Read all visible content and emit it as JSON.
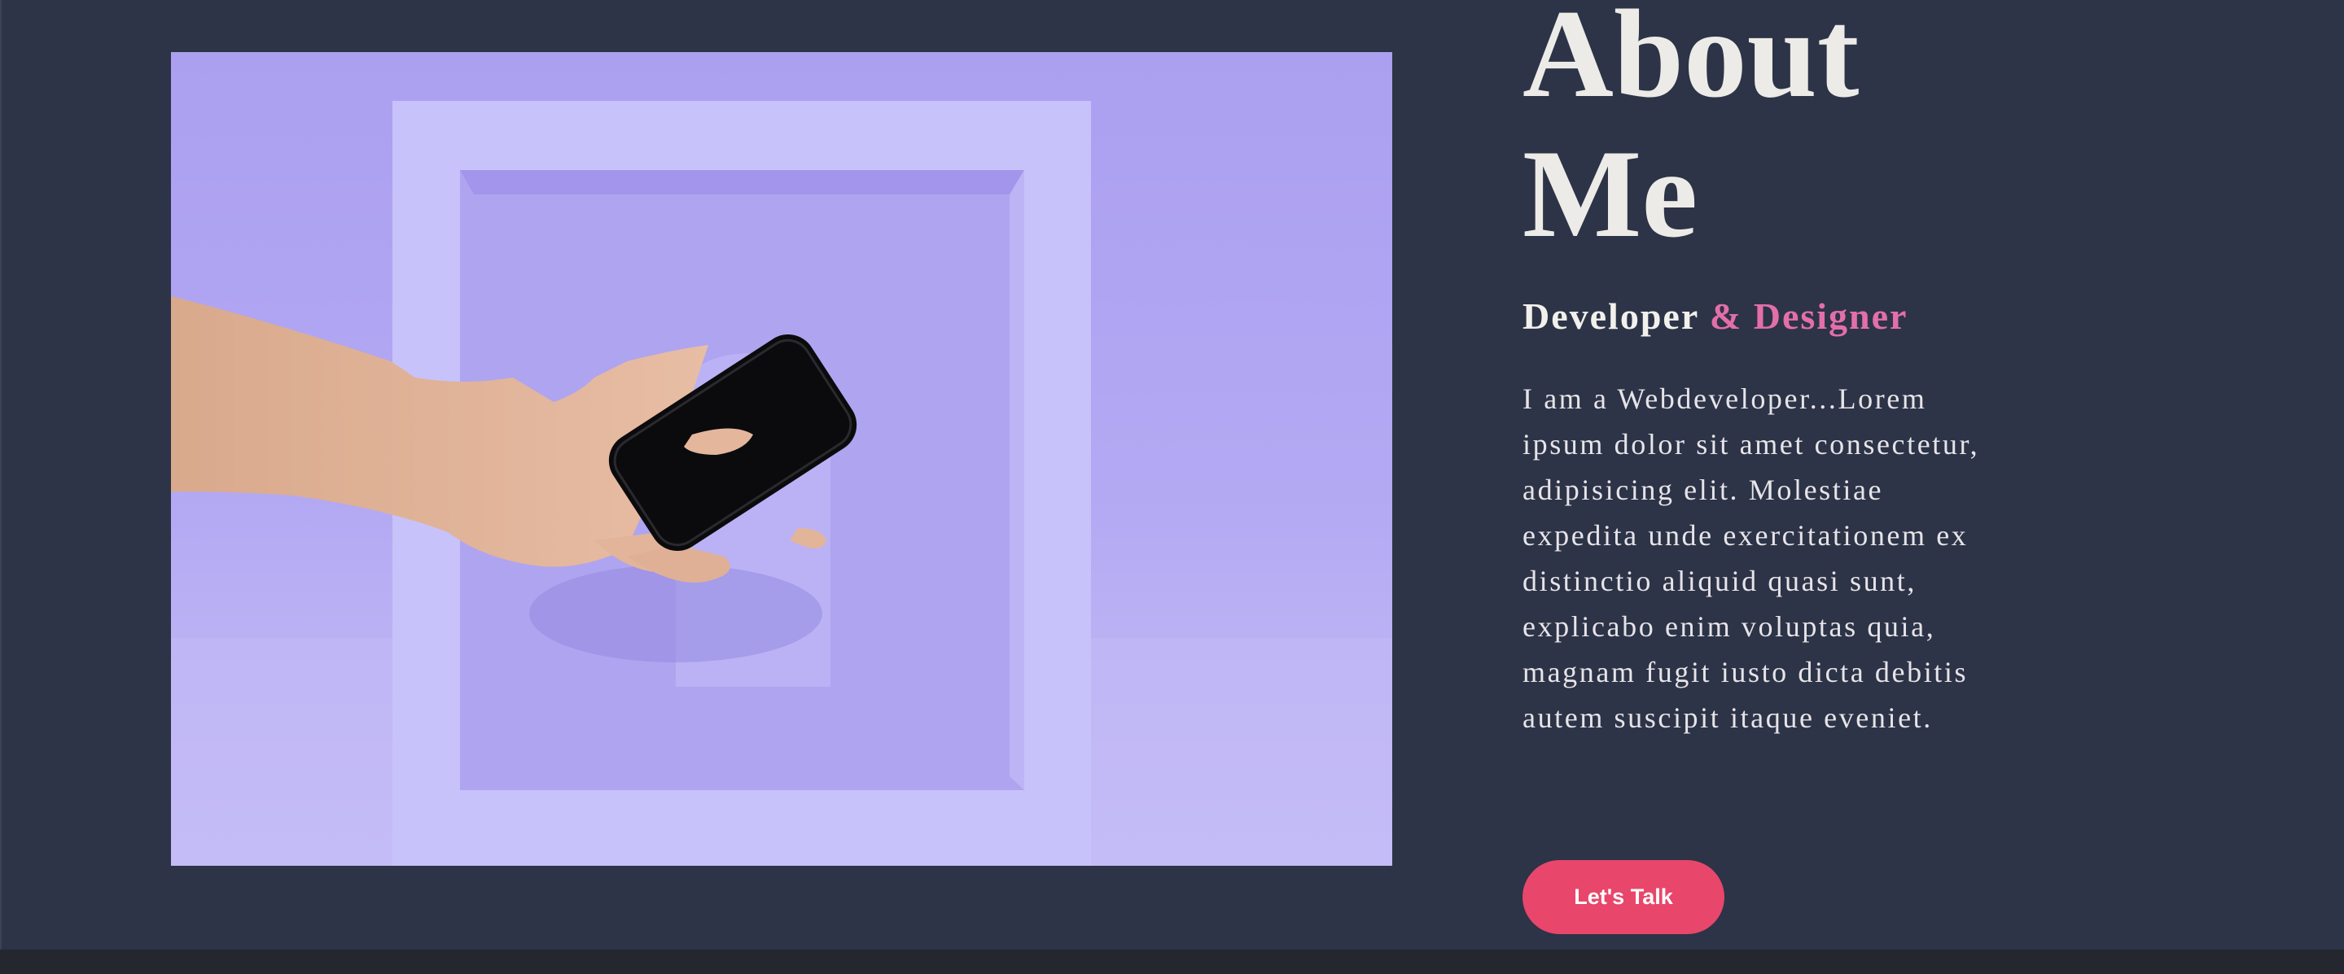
{
  "about": {
    "title_line1": "About",
    "title_line2": "Me",
    "role_primary": "Developer",
    "role_accent": "& Designer",
    "bio": "I am a Webdeveloper...Lorem ipsum dolor sit amet consectetur, adipisicing elit. Molestiae expedita unde exercitationem ex distinctio aliquid quasi sunt, explicabo enim voluptas quia, magnam fugit iusto dicta debitis autem suscipit itaque eveniet.",
    "cta_label": "Let's Talk"
  },
  "photo": {
    "description_icon": "hand-holding-phone-in-frame-photo"
  },
  "colors": {
    "background": "#2e3448",
    "footer": "#25272e",
    "title": "#ecebe8",
    "accent_pink": "#e36fa9",
    "cta": "#e8466a",
    "photo_lavender": "#b1a7f3"
  }
}
